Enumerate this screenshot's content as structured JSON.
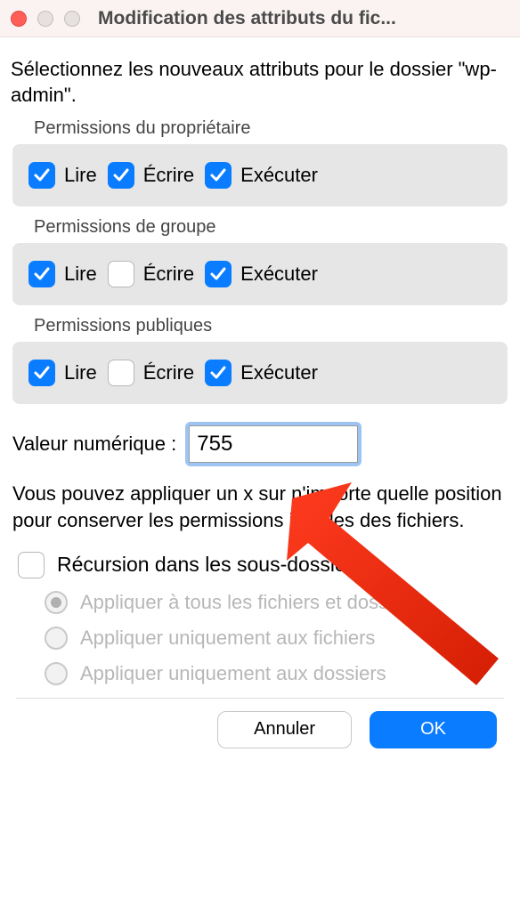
{
  "window": {
    "title": "Modification des attributs du fic..."
  },
  "prompt": "Sélectionnez les nouveaux attributs pour le dossier \"wp-admin\".",
  "groups": [
    {
      "label": "Permissions du propriétaire",
      "perms": [
        {
          "label": "Lire",
          "checked": true
        },
        {
          "label": "Écrire",
          "checked": true
        },
        {
          "label": "Exécuter",
          "checked": true
        }
      ]
    },
    {
      "label": "Permissions de groupe",
      "perms": [
        {
          "label": "Lire",
          "checked": true
        },
        {
          "label": "Écrire",
          "checked": false
        },
        {
          "label": "Exécuter",
          "checked": true
        }
      ]
    },
    {
      "label": "Permissions publiques",
      "perms": [
        {
          "label": "Lire",
          "checked": true
        },
        {
          "label": "Écrire",
          "checked": false
        },
        {
          "label": "Exécuter",
          "checked": true
        }
      ]
    }
  ],
  "numeric": {
    "label": "Valeur numérique :",
    "value": "755"
  },
  "hint": "Vous pouvez appliquer un x sur n'importe quelle position pour conserver les permissions initiales des fichiers.",
  "recurse": {
    "label": "Récursion dans les sous-dossiers",
    "checked": false,
    "options": [
      {
        "label": "Appliquer à tous les fichiers et dossiers",
        "selected": true
      },
      {
        "label": "Appliquer uniquement aux fichiers",
        "selected": false
      },
      {
        "label": "Appliquer uniquement aux dossiers",
        "selected": false
      }
    ]
  },
  "buttons": {
    "cancel": "Annuler",
    "ok": "OK"
  }
}
